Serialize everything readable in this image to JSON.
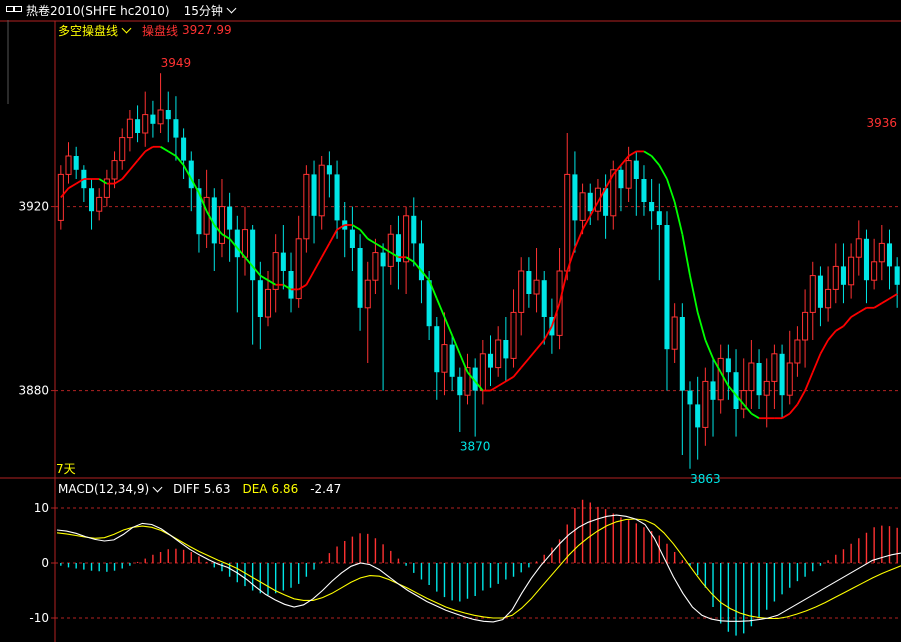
{
  "title": "热卷2010(SHFE hc2010)",
  "period": "15分钟",
  "main_legend": {
    "indicator": "多空操盘线",
    "line_label": "操盘线",
    "line_value": "3927.99"
  },
  "span_label": "7天",
  "macd_legend": {
    "indicator": "MACD(12,34,9)",
    "diff_label": "DIFF",
    "diff_value": "5.63",
    "dea_label": "DEA",
    "dea_value": "6.86",
    "macd_value": "-2.47"
  },
  "colors": {
    "up": "#ff3232",
    "down": "#00e6e6",
    "line_up": "#ff0000",
    "line_down": "#00ff00",
    "diff": "#ffffff",
    "dea": "#ffff00",
    "axis": "#b22222",
    "grid": "#b22222",
    "text": "#ffffff",
    "legend_yellow": "#ffff00"
  },
  "chart_data": {
    "type": "candlestick",
    "price_ticks": [
      "3920",
      "3880"
    ],
    "price_ylim": [
      3859,
      3961
    ],
    "marks": [
      {
        "text": "3949",
        "index": 15,
        "value": 3949
      },
      {
        "text": "3936",
        "index": 107,
        "value": 3936
      },
      {
        "text": "3870",
        "index": 54,
        "value": 3870
      },
      {
        "text": "3863",
        "index": 84,
        "value": 3863
      }
    ],
    "candles": [
      [
        3917,
        3927,
        3915,
        3929
      ],
      [
        3927,
        3931,
        3925,
        3934
      ],
      [
        3931,
        3928,
        3926,
        3933
      ],
      [
        3928,
        3924,
        3921,
        3929
      ],
      [
        3924,
        3919,
        3915,
        3926
      ],
      [
        3919,
        3922,
        3917,
        3924
      ],
      [
        3922,
        3926,
        3920,
        3928
      ],
      [
        3926,
        3930,
        3924,
        3932
      ],
      [
        3930,
        3935,
        3928,
        3937
      ],
      [
        3935,
        3939,
        3932,
        3941
      ],
      [
        3939,
        3936,
        3934,
        3942
      ],
      [
        3936,
        3940,
        3933,
        3945
      ],
      [
        3940,
        3938,
        3935,
        3943
      ],
      [
        3938,
        3941,
        3936,
        3949
      ],
      [
        3941,
        3939,
        3934,
        3945
      ],
      [
        3939,
        3935,
        3930,
        3944
      ],
      [
        3935,
        3930,
        3926,
        3937
      ],
      [
        3930,
        3924,
        3919,
        3932
      ],
      [
        3924,
        3914,
        3910,
        3926
      ],
      [
        3914,
        3922,
        3911,
        3928
      ],
      [
        3922,
        3912,
        3906,
        3924
      ],
      [
        3912,
        3920,
        3909,
        3926
      ],
      [
        3920,
        3915,
        3908,
        3923
      ],
      [
        3915,
        3909,
        3897,
        3918
      ],
      [
        3909,
        3915,
        3905,
        3920
      ],
      [
        3915,
        3904,
        3890,
        3916
      ],
      [
        3904,
        3896,
        3889,
        3908
      ],
      [
        3896,
        3902,
        3894,
        3906
      ],
      [
        3902,
        3910,
        3897,
        3914
      ],
      [
        3910,
        3906,
        3902,
        3916
      ],
      [
        3906,
        3900,
        3897,
        3910
      ],
      [
        3900,
        3913,
        3898,
        3918
      ],
      [
        3913,
        3927,
        3910,
        3929
      ],
      [
        3927,
        3918,
        3912,
        3930
      ],
      [
        3918,
        3929,
        3915,
        3931
      ],
      [
        3929,
        3927,
        3922,
        3932
      ],
      [
        3927,
        3917,
        3913,
        3930
      ],
      [
        3917,
        3915,
        3909,
        3921
      ],
      [
        3915,
        3911,
        3906,
        3920
      ],
      [
        3911,
        3898,
        3893,
        3914
      ],
      [
        3898,
        3904,
        3886,
        3908
      ],
      [
        3904,
        3910,
        3901,
        3913
      ],
      [
        3910,
        3907,
        3880,
        3912
      ],
      [
        3907,
        3914,
        3903,
        3916
      ],
      [
        3914,
        3908,
        3902,
        3918
      ],
      [
        3908,
        3918,
        3901,
        3920
      ],
      [
        3918,
        3912,
        3907,
        3922
      ],
      [
        3912,
        3904,
        3899,
        3917
      ],
      [
        3904,
        3894,
        3891,
        3906
      ],
      [
        3894,
        3884,
        3878,
        3896
      ],
      [
        3884,
        3890,
        3879,
        3897
      ],
      [
        3890,
        3883,
        3880,
        3892
      ],
      [
        3883,
        3879,
        3871,
        3885
      ],
      [
        3879,
        3885,
        3877,
        3888
      ],
      [
        3885,
        3880,
        3870,
        3887
      ],
      [
        3880,
        3888,
        3877,
        3891
      ],
      [
        3888,
        3885,
        3881,
        3892
      ],
      [
        3885,
        3891,
        3883,
        3894
      ],
      [
        3891,
        3887,
        3882,
        3896
      ],
      [
        3887,
        3897,
        3885,
        3902
      ],
      [
        3897,
        3906,
        3892,
        3909
      ],
      [
        3906,
        3901,
        3898,
        3909
      ],
      [
        3901,
        3904,
        3897,
        3911
      ],
      [
        3904,
        3896,
        3890,
        3906
      ],
      [
        3896,
        3892,
        3888,
        3900
      ],
      [
        3892,
        3906,
        3889,
        3911
      ],
      [
        3906,
        3927,
        3904,
        3936
      ],
      [
        3927,
        3917,
        3910,
        3932
      ],
      [
        3917,
        3923,
        3914,
        3925
      ],
      [
        3923,
        3919,
        3916,
        3925
      ],
      [
        3919,
        3924,
        3917,
        3926
      ],
      [
        3924,
        3918,
        3913,
        3927
      ],
      [
        3918,
        3928,
        3915,
        3930
      ],
      [
        3928,
        3924,
        3919,
        3929
      ],
      [
        3924,
        3930,
        3921,
        3933
      ],
      [
        3930,
        3926,
        3918,
        3932
      ],
      [
        3926,
        3921,
        3918,
        3929
      ],
      [
        3921,
        3919,
        3915,
        3926
      ],
      [
        3919,
        3916,
        3904,
        3925
      ],
      [
        3916,
        3889,
        3880,
        3919
      ],
      [
        3889,
        3896,
        3886,
        3899
      ],
      [
        3896,
        3880,
        3866,
        3899
      ],
      [
        3880,
        3877,
        3863,
        3882
      ],
      [
        3877,
        3872,
        3865,
        3883
      ],
      [
        3872,
        3882,
        3868,
        3885
      ],
      [
        3882,
        3878,
        3870,
        3887
      ],
      [
        3878,
        3887,
        3875,
        3890
      ],
      [
        3887,
        3884,
        3878,
        3890
      ],
      [
        3884,
        3876,
        3870,
        3889
      ],
      [
        3876,
        3880,
        3874,
        3887
      ],
      [
        3880,
        3886,
        3876,
        3891
      ],
      [
        3886,
        3879,
        3876,
        3889
      ],
      [
        3879,
        3882,
        3872,
        3887
      ],
      [
        3882,
        3888,
        3876,
        3890
      ],
      [
        3888,
        3879,
        3874,
        3890
      ],
      [
        3879,
        3886,
        3877,
        3893
      ],
      [
        3886,
        3891,
        3883,
        3894
      ],
      [
        3891,
        3897,
        3885,
        3902
      ],
      [
        3897,
        3905,
        3891,
        3908
      ],
      [
        3905,
        3898,
        3894,
        3907
      ],
      [
        3898,
        3902,
        3895,
        3907
      ],
      [
        3902,
        3907,
        3899,
        3912
      ],
      [
        3907,
        3903,
        3899,
        3912
      ],
      [
        3903,
        3909,
        3900,
        3912
      ],
      [
        3909,
        3913,
        3905,
        3917
      ],
      [
        3913,
        3904,
        3899,
        3915
      ],
      [
        3904,
        3908,
        3902,
        3913
      ],
      [
        3908,
        3912,
        3904,
        3916
      ],
      [
        3912,
        3907,
        3902,
        3915
      ],
      [
        3907,
        3903,
        3898,
        3909
      ]
    ],
    "trend_line": [
      3922,
      3924,
      3925,
      3926,
      3926,
      3926,
      3925,
      3925,
      3926,
      3928,
      3930,
      3932,
      3933,
      3933,
      3932,
      3931,
      3929,
      3926,
      3923,
      3919,
      3916,
      3914,
      3913,
      3911,
      3909,
      3907,
      3905,
      3904,
      3903,
      3903,
      3902,
      3902,
      3903,
      3906,
      3909,
      3912,
      3915,
      3916,
      3916,
      3915,
      3913,
      3912,
      3911,
      3910,
      3909,
      3909,
      3908,
      3906,
      3904,
      3900,
      3896,
      3892,
      3888,
      3884,
      3882,
      3880,
      3880,
      3881,
      3882,
      3883,
      3885,
      3887,
      3889,
      3891,
      3894,
      3899,
      3906,
      3911,
      3915,
      3918,
      3921,
      3924,
      3927,
      3929,
      3931,
      3932,
      3932,
      3931,
      3929,
      3926,
      3921,
      3914,
      3905,
      3897,
      3891,
      3887,
      3884,
      3881,
      3879,
      3877,
      3875,
      3874,
      3874,
      3874,
      3874,
      3875,
      3877,
      3880,
      3884,
      3888,
      3891,
      3893,
      3894,
      3896,
      3897,
      3898,
      3898,
      3899,
      3900,
      3901
    ],
    "macd_ticks": [
      "10",
      "0",
      "-10"
    ],
    "macd_ylim": [
      -14,
      13
    ],
    "macd_hist": [
      -0.5,
      -0.8,
      -1.0,
      -1.2,
      -1.4,
      -1.5,
      -1.6,
      -1.4,
      -1.0,
      -0.5,
      0.2,
      0.8,
      1.5,
      2.0,
      2.5,
      2.6,
      2.4,
      2.0,
      1.2,
      0.2,
      -0.8,
      -1.5,
      -2.5,
      -3.5,
      -4.2,
      -5.0,
      -5.5,
      -5.8,
      -5.5,
      -5.0,
      -4.5,
      -3.8,
      -2.5,
      -1.2,
      0.3,
      1.8,
      3.0,
      4.0,
      4.8,
      5.4,
      5.3,
      4.5,
      3.4,
      2.2,
      0.8,
      -0.5,
      -1.8,
      -3.0,
      -4.0,
      -5.2,
      -6.2,
      -6.8,
      -7.0,
      -6.5,
      -6.0,
      -5.0,
      -4.5,
      -3.8,
      -3.0,
      -2.5,
      -1.7,
      -0.8,
      0.3,
      1.5,
      2.8,
      4.3,
      7.0,
      10.0,
      11.5,
      11.0,
      10.2,
      9.8,
      9.0,
      8.3,
      7.8,
      7.2,
      6.5,
      5.8,
      5.0,
      3.5,
      2.0,
      0.5,
      -0.5,
      -2.2,
      -4.5,
      -8.0,
      -11.0,
      -12.5,
      -13.2,
      -12.8,
      -11.5,
      -10.0,
      -8.5,
      -7.0,
      -5.7,
      -4.5,
      -3.3,
      -2.5,
      -1.5,
      -0.5,
      0.5,
      1.5,
      2.5,
      3.5,
      4.5,
      5.5,
      6.5,
      6.8,
      6.7,
      6.4
    ],
    "diff": [
      6.0,
      5.8,
      5.4,
      4.8,
      4.3,
      4.0,
      4.2,
      5.2,
      6.5,
      7.2,
      7.0,
      6.2,
      5.0,
      3.7,
      2.5,
      1.5,
      0.6,
      -0.2,
      -0.8,
      -1.8,
      -3.0,
      -4.4,
      -5.7,
      -6.7,
      -7.5,
      -8.0,
      -7.6,
      -6.5,
      -5.0,
      -3.3,
      -1.8,
      -0.6,
      0.0,
      -0.3,
      -1.2,
      -2.5,
      -3.8,
      -5.0,
      -6.0,
      -7.0,
      -7.8,
      -8.6,
      -9.2,
      -9.8,
      -10.3,
      -10.6,
      -10.7,
      -10.3,
      -8.5,
      -5.5,
      -2.8,
      -0.5,
      1.5,
      3.5,
      5.2,
      6.5,
      7.4,
      8.0,
      8.5,
      8.7,
      8.5,
      8.0,
      7.0,
      4.5,
      1.0,
      -2.5,
      -5.5,
      -8.0,
      -9.5,
      -10.2,
      -10.5,
      -10.6,
      -10.6,
      -10.5,
      -10.3,
      -10.0,
      -9.5,
      -8.5,
      -7.5,
      -6.5,
      -5.5,
      -4.5,
      -3.5,
      -2.5,
      -1.5,
      -0.5,
      0.5,
      1.0,
      1.5,
      1.8
    ],
    "dea": [
      5.5,
      5.3,
      5.0,
      4.7,
      4.5,
      4.6,
      5.2,
      6.0,
      6.5,
      6.7,
      6.5,
      5.9,
      5.0,
      4.0,
      3.0,
      2.1,
      1.3,
      0.5,
      -0.2,
      -1.0,
      -2.0,
      -3.0,
      -4.0,
      -5.0,
      -5.8,
      -6.5,
      -6.8,
      -6.8,
      -6.3,
      -5.5,
      -4.5,
      -3.5,
      -2.7,
      -2.3,
      -2.4,
      -3.0,
      -3.8,
      -4.6,
      -5.5,
      -6.4,
      -7.2,
      -8.0,
      -8.6,
      -9.1,
      -9.5,
      -9.8,
      -10.0,
      -10.0,
      -9.5,
      -8.2,
      -6.5,
      -4.5,
      -2.5,
      -0.5,
      1.5,
      3.2,
      4.6,
      5.8,
      6.8,
      7.5,
      7.9,
      8.0,
      7.8,
      7.0,
      5.5,
      3.5,
      1.2,
      -1.2,
      -3.5,
      -5.5,
      -7.2,
      -8.3,
      -9.1,
      -9.6,
      -9.9,
      -10.1,
      -10.1,
      -9.8,
      -9.3,
      -8.7,
      -8.0,
      -7.2,
      -6.3,
      -5.4,
      -4.5,
      -3.6,
      -2.7,
      -1.9,
      -1.2,
      -0.5
    ]
  }
}
